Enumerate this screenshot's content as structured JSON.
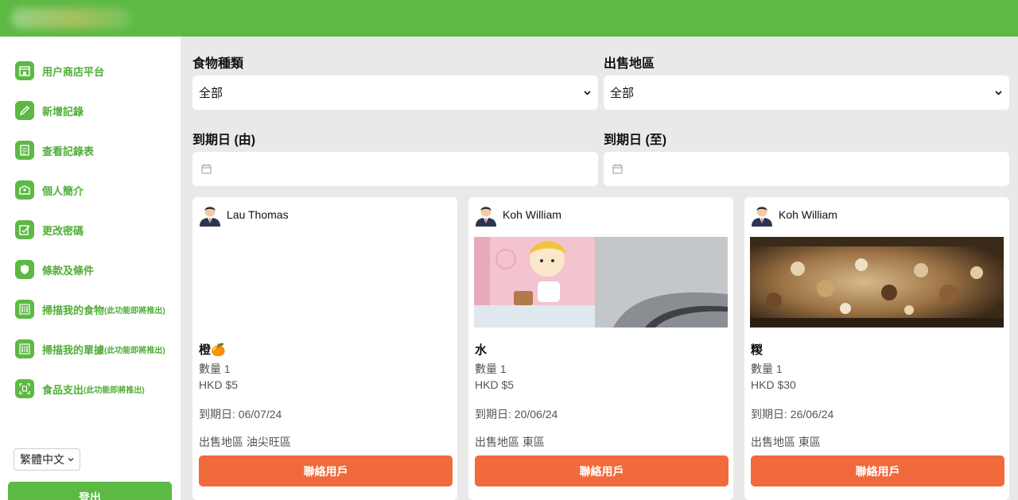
{
  "sidebar": {
    "items": [
      {
        "label": "用户商店平台",
        "note": "",
        "icon": "store-icon"
      },
      {
        "label": "新增記錄",
        "note": "",
        "icon": "pencil-icon"
      },
      {
        "label": "查看記錄表",
        "note": "",
        "icon": "document-icon"
      },
      {
        "label": "個人簡介",
        "note": "",
        "icon": "profile-box-icon"
      },
      {
        "label": "更改密碼",
        "note": "",
        "icon": "edit-check-icon"
      },
      {
        "label": "條款及條件",
        "note": "",
        "icon": "shield-icon"
      },
      {
        "label": "掃描我的食物",
        "note": "(此功能即將推出)",
        "icon": "barcode-icon"
      },
      {
        "label": "掃描我的單據",
        "note": "(此功能即將推出)",
        "icon": "barcode-icon"
      },
      {
        "label": "食品支出",
        "note": "(此功能即將推出)",
        "icon": "receipt-scan-icon"
      }
    ],
    "language": "繁體中文",
    "logout": "登出"
  },
  "filters": {
    "food_type_label": "食物種類",
    "food_type_value": "全部",
    "region_label": "出售地區",
    "region_value": "全部",
    "expiry_from_label": "到期日 (由)",
    "expiry_to_label": "到期日 (至)"
  },
  "cards": [
    {
      "user": "Lau Thomas",
      "title": "橙🍊",
      "quantity": "數量 1",
      "price": "HKD $5",
      "expiry": "到期日: 06/07/24",
      "region": "出售地區 油尖旺區",
      "button": "聯絡用戶",
      "image": "none"
    },
    {
      "user": "Koh William",
      "title": "水",
      "quantity": "數量 1",
      "price": "HKD $5",
      "expiry": "到期日: 20/06/24",
      "region": "出售地區 東區",
      "button": "聯絡用戶",
      "image": "water-bottle-photo"
    },
    {
      "user": "Koh William",
      "title": "糉",
      "quantity": "數量 1",
      "price": "HKD $30",
      "expiry": "到期日: 26/06/24",
      "region": "出售地區 東區",
      "button": "聯絡用戶",
      "image": "rice-dumpling-photo"
    }
  ],
  "colors": {
    "brand_green": "#5cb944",
    "accent_orange": "#f06a3c"
  }
}
